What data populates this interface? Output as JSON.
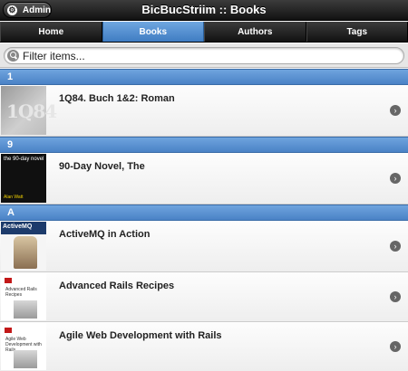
{
  "header": {
    "title": "BicBucStriim :: Books",
    "admin_label": "Admin"
  },
  "tabs": [
    {
      "label": "Home",
      "active": false
    },
    {
      "label": "Books",
      "active": true
    },
    {
      "label": "Authors",
      "active": false
    },
    {
      "label": "Tags",
      "active": false
    }
  ],
  "filter": {
    "placeholder": "Filter items..."
  },
  "groups": [
    {
      "letter": "1",
      "books": [
        {
          "title": "1Q84. Buch 1&2: Roman",
          "cover_text": "1Q84"
        }
      ]
    },
    {
      "letter": "9",
      "books": [
        {
          "title": "90-Day Novel, The",
          "cover_text": "the 90-day novel",
          "cover_author": "Alan Watt"
        }
      ]
    },
    {
      "letter": "A",
      "books": [
        {
          "title": "ActiveMQ in Action",
          "cover_text": "ActiveMQ"
        },
        {
          "title": "Advanced Rails Recipes",
          "cover_text": "Advanced Rails Recipes"
        },
        {
          "title": "Agile Web Development with Rails",
          "cover_text": "Agile Web Development with Rails"
        }
      ]
    }
  ],
  "colors": {
    "accent": "#4a82c6",
    "header_dark": "#111111"
  }
}
